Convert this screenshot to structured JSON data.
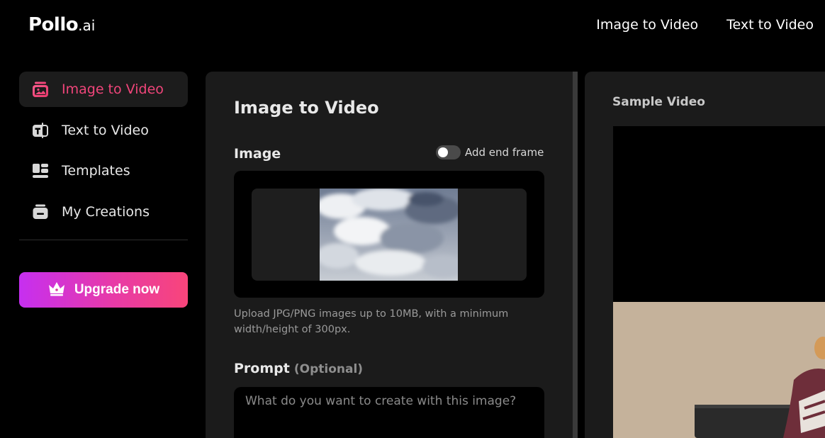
{
  "header": {
    "logo_main": "Pollo",
    "logo_suffix": ".ai",
    "nav": [
      {
        "label": "Image to Video"
      },
      {
        "label": "Text to Video"
      }
    ]
  },
  "sidebar": {
    "items": [
      {
        "label": "Image to Video",
        "icon": "image-icon",
        "active": true
      },
      {
        "label": "Text to Video",
        "icon": "text-icon",
        "active": false
      },
      {
        "label": "Templates",
        "icon": "templates-icon",
        "active": false
      },
      {
        "label": "My Creations",
        "icon": "creations-icon",
        "active": false
      }
    ],
    "upgrade_label": "Upgrade now"
  },
  "main": {
    "title": "Image to Video",
    "image_label": "Image",
    "end_frame_label": "Add end frame",
    "end_frame_enabled": false,
    "upload_hint": "Upload JPG/PNG images up to 10MB, with a minimum width/height of 300px.",
    "prompt_label": "Prompt",
    "prompt_optional": "(Optional)",
    "prompt_placeholder": "What do you want to create with this image?"
  },
  "sample": {
    "title": "Sample Video"
  },
  "colors": {
    "accent": "#f0457a",
    "upgrade_gradient_start": "#c62ff0",
    "upgrade_gradient_end": "#f8457a",
    "panel_bg": "#1b1b1b"
  }
}
